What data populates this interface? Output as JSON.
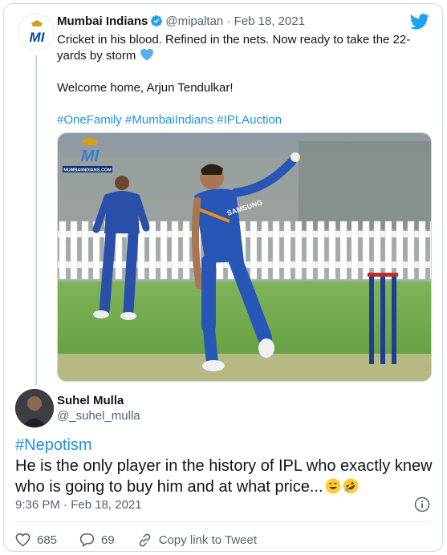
{
  "quoted_tweet": {
    "display_name": "Mumbai Indians",
    "handle": "@mipaltan",
    "separator": "·",
    "date": "Feb 18, 2021",
    "text_line_1": "Cricket in his blood. Refined in the nets. Now ready to take the 22-yards by storm",
    "text_line_2": "Welcome home, Arjun Tendulkar!",
    "hashtags": "#OneFamily #MumbaiIndians #IPLAuction",
    "image_watermark": "MUMBAIINDIANS.COM",
    "jersey_text": "SAMSUNG"
  },
  "reply": {
    "display_name": "Suhel Mulla",
    "handle": "@_suhel_mulla",
    "hashtag": "#Nepotism",
    "text": "He is the only player in the history of IPL who exactly knew who is going to buy him and at what price...",
    "timestamp": "9:36 PM · Feb 18, 2021"
  },
  "actions": {
    "like_count": "685",
    "reply_count": "69",
    "copy_label": "Copy link to Tweet"
  },
  "icons": {
    "twitter": "twitter-bird-icon",
    "verified": "verified-badge-icon",
    "heart_emoji": "blue-heart-emoji",
    "info": "info-icon",
    "like": "heart-outline-icon",
    "reply": "comment-icon",
    "link": "link-icon"
  },
  "colors": {
    "link_blue": "#1b95e0",
    "twitter_blue": "#1da1f2",
    "secondary_text": "#536471",
    "mi_blue": "#004ba0"
  }
}
